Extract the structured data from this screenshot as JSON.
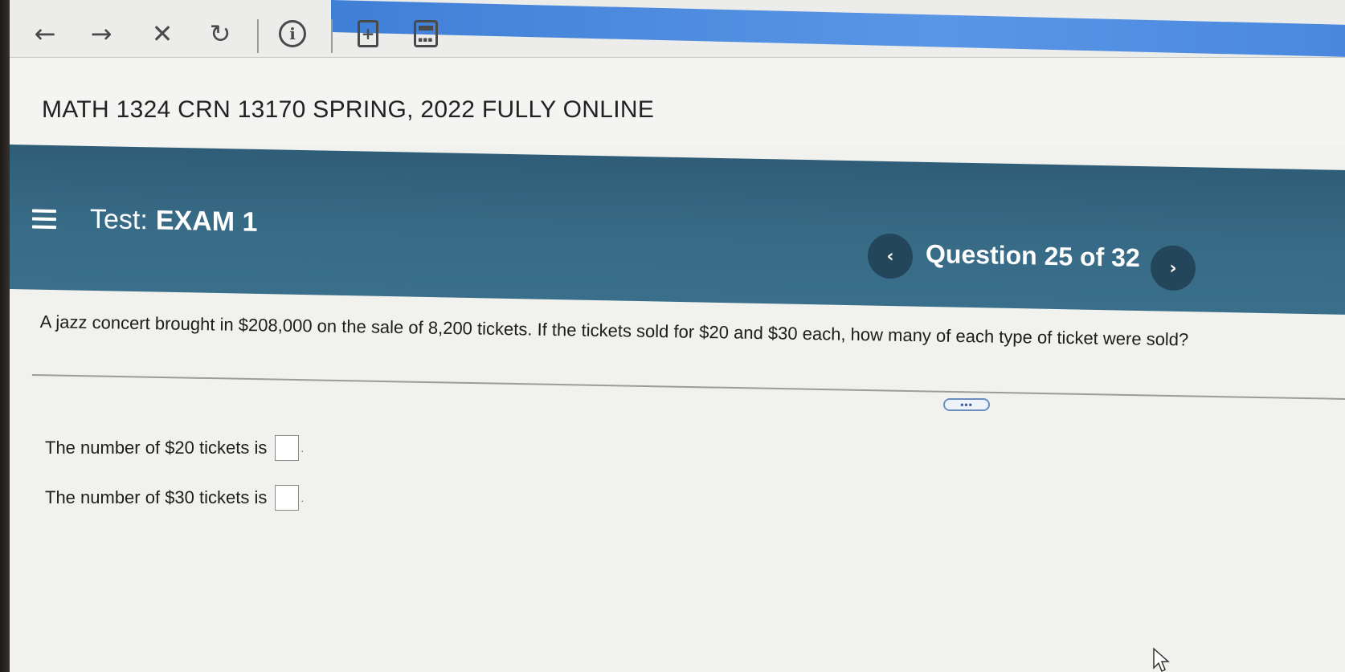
{
  "toolbar": {
    "back_icon": "←",
    "forward_icon": "→",
    "close_icon": "✕",
    "refresh_icon": "↻",
    "info_icon": "i",
    "doc_icon": "+"
  },
  "course": {
    "title": "MATH 1324 CRN 13170 SPRING, 2022 FULLY ONLINE"
  },
  "test": {
    "label": "Test:",
    "name": "EXAM 1",
    "question_counter": "Question 25 of 32",
    "prev": "‹",
    "next": "›"
  },
  "question": {
    "text": "A jazz concert brought in $208,000 on the sale of 8,200 tickets. If the tickets sold for  $20 and $30 each, how many of each type of ticket were sold?",
    "more_label": "•••",
    "answers": [
      {
        "label": "The number of $20 tickets is",
        "value": ""
      },
      {
        "label": "The number of $30 tickets is",
        "value": ""
      }
    ]
  },
  "colors": {
    "header_bg": "#376a85",
    "nav_btn_bg": "#24465b",
    "page_bg": "#f1f1ee"
  }
}
